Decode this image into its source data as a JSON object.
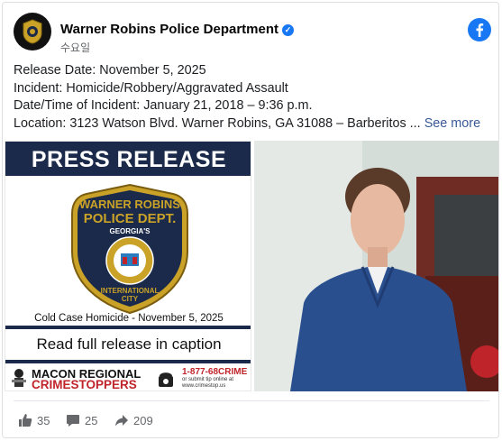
{
  "post": {
    "page_name": "Warner Robins Police Department",
    "timestamp": "수요일",
    "text_lines": [
      "Release Date: November 5, 2025",
      "Incident: Homicide/Robbery/Aggravated Assault",
      "Date/Time of Incident: January 21, 2018 – 9:36 p.m.",
      "Location: 3123 Watson Blvd. Warner Robins, GA 31088 – Barberitos ..."
    ],
    "see_more": "See more"
  },
  "flyer": {
    "banner": "PRESS RELEASE",
    "badge_text": [
      "WARNER ROBINS",
      "POLICE DEPT.",
      "GEORGIA'S",
      "INTERNATIONAL",
      "CITY"
    ],
    "cold_case": "Cold Case Homicide - November 5, 2025",
    "read_full": "Read full release in caption",
    "crimestoppers_line1": "MACON REGIONAL",
    "crimestoppers_line2": "CRIMESTOPPERS",
    "phone": "1-877-68CRIME",
    "phone_sub": "or submit tip online at www.crimestop.us"
  },
  "engagement": {
    "likes": "35",
    "comments": "25",
    "shares": "209"
  },
  "colors": {
    "navy": "#1b2a4a",
    "brand_blue": "#1877f2",
    "crimestoppers_red": "#c0242b"
  },
  "icons": [
    "avatar-badge-icon",
    "verified-icon",
    "facebook-logo-icon",
    "like-icon",
    "comment-icon",
    "share-icon"
  ]
}
